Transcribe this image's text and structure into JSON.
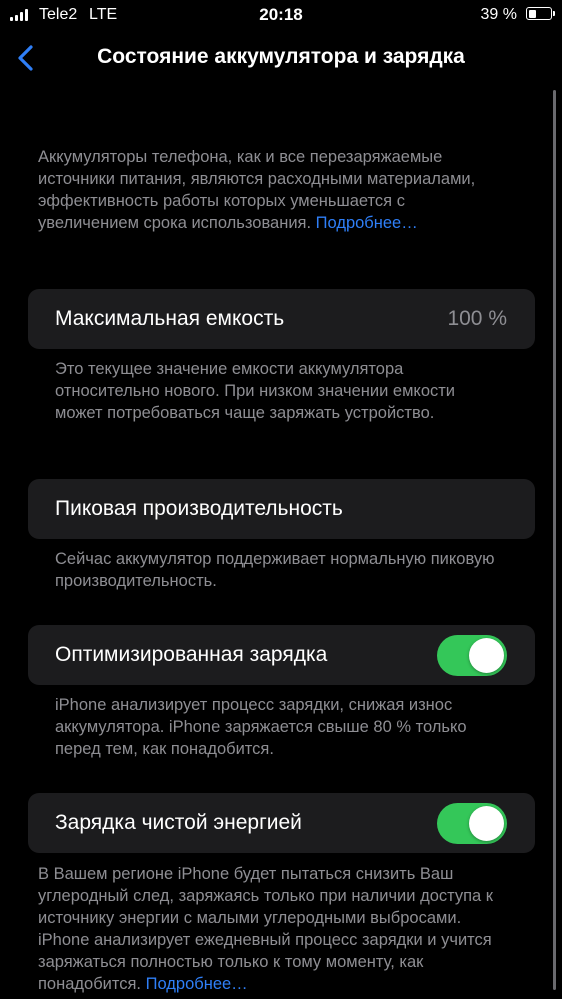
{
  "status_bar": {
    "carrier": "Tele2",
    "network": "LTE",
    "time": "20:18",
    "battery_percent": "39 %",
    "battery_level": 0.39
  },
  "nav": {
    "back_icon": "chevron-left-icon",
    "title": "Состояние аккумулятора и зарядка"
  },
  "intro": {
    "text": "Аккумуляторы телефона, как и все перезаряжаемые источники питания, являются расходными материалами, эффективность работы которых уменьшается с увеличением срока использования.",
    "link": "Подробнее…"
  },
  "max_capacity": {
    "label": "Максимальная емкость",
    "value": "100 %",
    "footer": "Это текущее значение емкости аккумулятора относительно нового. При низком значении емкости может потребоваться чаще заряжать устройство."
  },
  "peak_performance": {
    "label": "Пиковая производительность",
    "footer": "Сейчас аккумулятор поддерживает нормальную пиковую производительность."
  },
  "optimized_charging": {
    "label": "Оптимизированная зарядка",
    "enabled": true,
    "footer": "iPhone анализирует процесс зарядки, снижая износ аккумулятора. iPhone заряжается свыше 80 % только перед тем, как понадобится."
  },
  "clean_energy": {
    "label": "Зарядка чистой энергией",
    "enabled": true,
    "footer": "В Вашем регионе iPhone будет пытаться снизить Ваш углеродный след, заряжаясь только при наличии доступа к источнику энергии с малыми углеродными выбросами. iPhone анализирует ежедневный процесс зарядки и учится заряжаться полностью только к тому моменту, как понадобится.",
    "link": "Подробнее…"
  },
  "colors": {
    "background": "#000000",
    "cell": "#1c1c1e",
    "secondary_text": "#8e8e93",
    "link": "#2f7ff7",
    "toggle_on": "#34c759"
  }
}
